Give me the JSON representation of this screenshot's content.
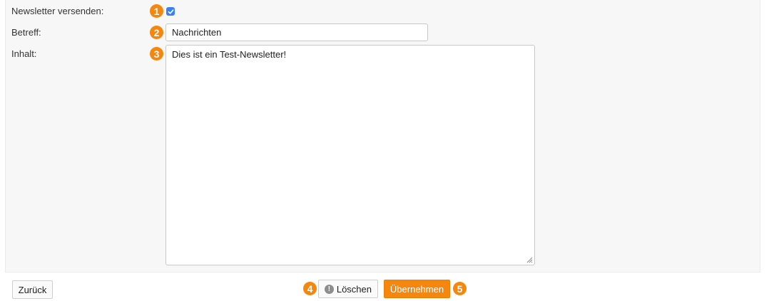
{
  "form": {
    "newsletter_label": "Newsletter versenden:",
    "subject_label": "Betreff:",
    "content_label": "Inhalt:",
    "subject_value": "Nachrichten",
    "content_value": "Dies ist ein Test-Newsletter!",
    "newsletter_checked": true
  },
  "badges": [
    "1",
    "2",
    "3",
    "4",
    "5"
  ],
  "buttons": {
    "back": "Zurück",
    "delete": "Löschen",
    "apply": "Übernehmen"
  },
  "colors": {
    "accent": "#f5870f",
    "checkbox": "#3a80f3"
  }
}
